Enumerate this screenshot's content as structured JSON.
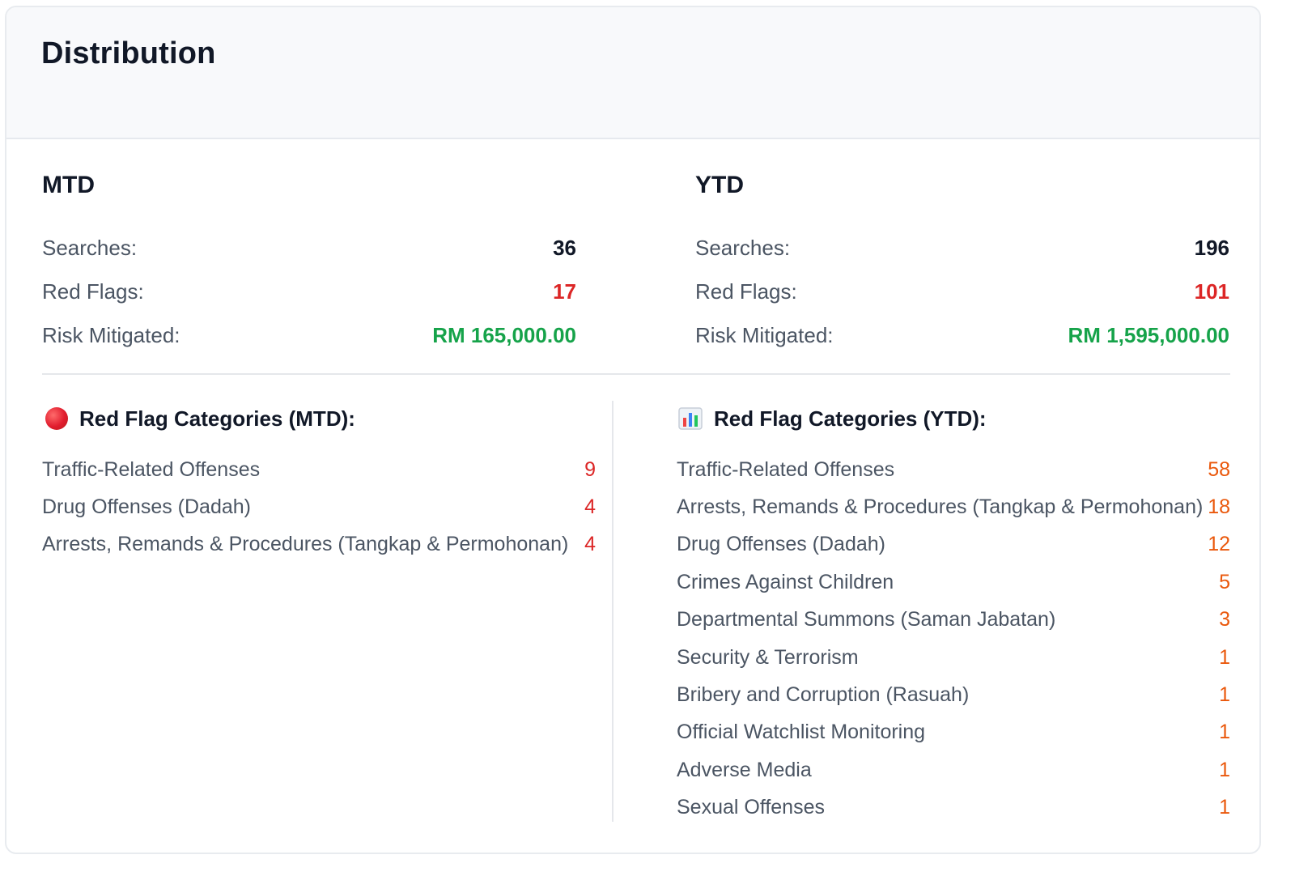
{
  "title": "Distribution",
  "mtd": {
    "heading": "MTD",
    "stats": [
      {
        "label": "Searches:",
        "value": "36"
      },
      {
        "label": "Red Flags:",
        "value": "17"
      },
      {
        "label": "Risk Mitigated:",
        "value": "RM 165,000.00"
      }
    ]
  },
  "ytd": {
    "heading": "YTD",
    "stats": [
      {
        "label": "Searches:",
        "value": "196"
      },
      {
        "label": "Red Flags:",
        "value": "101"
      },
      {
        "label": "Risk Mitigated:",
        "value": "RM 1,595,000.00"
      }
    ]
  },
  "mtd_categories": {
    "icon": "red-circle-icon",
    "heading": "Red Flag Categories (MTD):",
    "items": [
      {
        "label": "Traffic-Related Offenses",
        "count": "9"
      },
      {
        "label": "Drug Offenses (Dadah)",
        "count": "4"
      },
      {
        "label": "Arrests, Remands & Procedures (Tangkap & Permohonan)",
        "count": "4"
      }
    ]
  },
  "ytd_categories": {
    "icon": "bar-chart-icon",
    "heading": "Red Flag Categories (YTD):",
    "items": [
      {
        "label": "Traffic-Related Offenses",
        "count": "58"
      },
      {
        "label": "Arrests, Remands & Procedures (Tangkap & Permohonan)",
        "count": "18"
      },
      {
        "label": "Drug Offenses (Dadah)",
        "count": "12"
      },
      {
        "label": "Crimes Against Children",
        "count": "5"
      },
      {
        "label": "Departmental Summons (Saman Jabatan)",
        "count": "3"
      },
      {
        "label": "Security & Terrorism",
        "count": "1"
      },
      {
        "label": "Bribery and Corruption (Rasuah)",
        "count": "1"
      },
      {
        "label": "Official Watchlist Monitoring",
        "count": "1"
      },
      {
        "label": "Adverse Media",
        "count": "1"
      },
      {
        "label": "Sexual Offenses",
        "count": "1"
      }
    ]
  },
  "colors": {
    "red": "#dc2626",
    "green": "#16a34a",
    "orange": "#ea580c"
  }
}
